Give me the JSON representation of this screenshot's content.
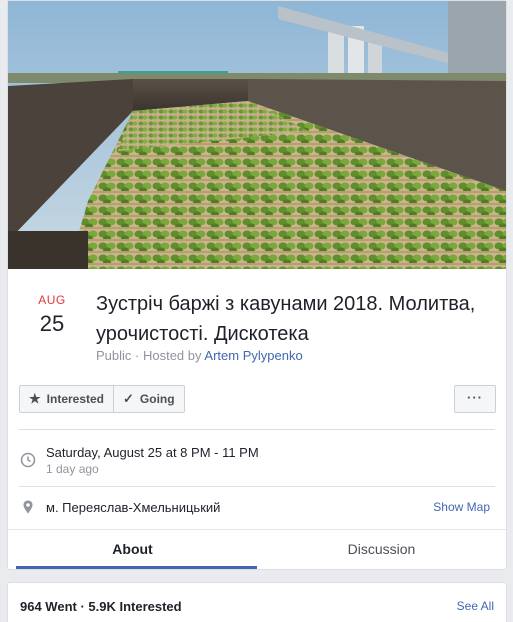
{
  "event": {
    "month": "AUG",
    "day": "25",
    "title": "Зустріч баржі з кавунами 2018. Молитва, урочистості. Дискотека",
    "privacy": "Public",
    "hosted_by_prefix": " · Hosted by ",
    "host": "Artem Pylypenko"
  },
  "actions": {
    "interested_label": "Interested",
    "going_label": "Going",
    "more_label": "···",
    "interested_icon": "star-icon",
    "going_icon": "check-icon"
  },
  "details": {
    "datetime": "Saturday, August 25 at 8 PM - 11 PM",
    "relative_time": "1 day ago",
    "location": "м. Переяслав-Хмельницький",
    "show_map": "Show Map",
    "time_icon": "clock-icon",
    "location_icon": "map-pin-icon"
  },
  "tabs": [
    {
      "label": "About",
      "active": true
    },
    {
      "label": "Discussion",
      "active": false
    }
  ],
  "stats": {
    "summary": "964 Went · 5.9K Interested",
    "see_all": "See All"
  },
  "colors": {
    "accent": "#4267b2",
    "month_red": "#e0383e",
    "background": "#e9ebee"
  }
}
